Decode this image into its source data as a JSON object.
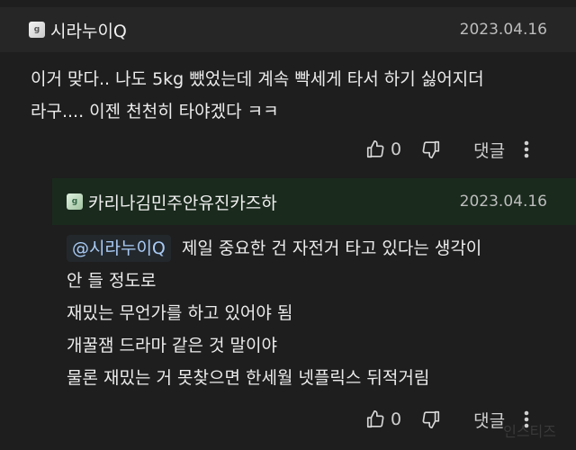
{
  "comments": [
    {
      "badge": "g",
      "author": "시라누이Q",
      "date": "2023.04.16",
      "lines": [
        "이거 맞다.. 나도 5kg 뺐었는데 계속 빡세게 타서 하기 싫어지더",
        "라구.... 이젠 천천히 타야겠다 ㅋㅋ"
      ],
      "like_count": "0",
      "reply_label": "댓글"
    },
    {
      "badge": "g",
      "author": "카리나김민주안유진카즈하",
      "date": "2023.04.16",
      "mention": "@시라누이Q",
      "first_line_rest": "제일 중요한 건 자전거 타고 있다는 생각이",
      "lines": [
        "안 들 정도로",
        "재밌는 무언가를 하고 있어야 됨",
        "개꿀잼 드라마 같은 것 말이야",
        "물론 재밌는 거 못찾으면 한세월 넷플릭스 뒤적거림"
      ],
      "like_count": "0",
      "reply_label": "댓글"
    }
  ],
  "watermark": "인스티즈",
  "icons": [
    "thumbs-up-icon",
    "thumbs-down-icon",
    "more-vertical-icon"
  ]
}
